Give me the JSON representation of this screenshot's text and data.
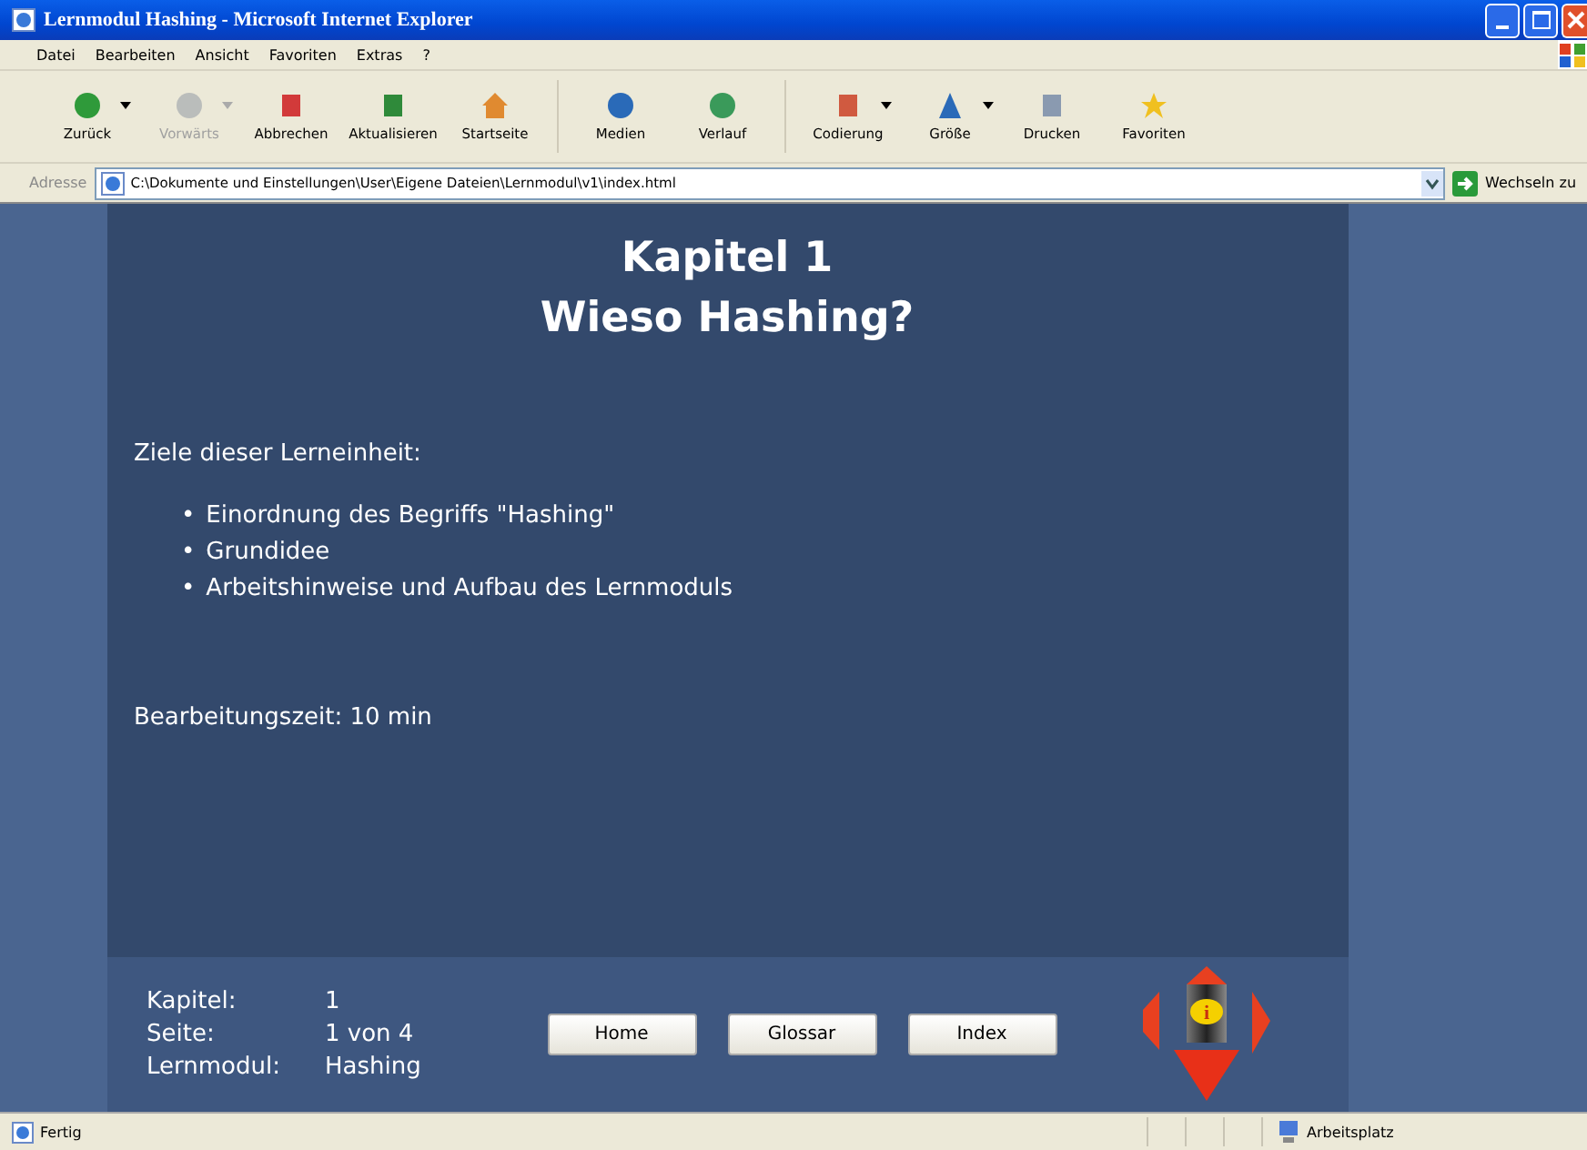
{
  "window": {
    "title": "Lernmodul Hashing - Microsoft Internet Explorer"
  },
  "menu": [
    "Datei",
    "Bearbeiten",
    "Ansicht",
    "Favoriten",
    "Extras",
    "?"
  ],
  "toolbar": [
    {
      "kind": "back",
      "label": "Zurück",
      "disabled": false,
      "dropdown": true
    },
    {
      "kind": "forward",
      "label": "Vorwärts",
      "disabled": true,
      "dropdown": true
    },
    {
      "kind": "stop",
      "label": "Abbrechen",
      "disabled": false,
      "dropdown": false
    },
    {
      "kind": "refresh",
      "label": "Aktualisieren",
      "disabled": false,
      "dropdown": false
    },
    {
      "kind": "home",
      "label": "Startseite",
      "disabled": false,
      "dropdown": false
    },
    {
      "kind": "media",
      "label": "Medien",
      "disabled": false,
      "dropdown": false
    },
    {
      "kind": "history",
      "label": "Verlauf",
      "disabled": false,
      "dropdown": false
    },
    {
      "kind": "encoding",
      "label": "Codierung",
      "disabled": false,
      "dropdown": true
    },
    {
      "kind": "size",
      "label": "Größe",
      "disabled": false,
      "dropdown": true
    },
    {
      "kind": "print",
      "label": "Drucken",
      "disabled": false,
      "dropdown": false
    },
    {
      "kind": "favorites",
      "label": "Favoriten",
      "disabled": false,
      "dropdown": false
    }
  ],
  "address": {
    "label": "Adresse",
    "value": "C:\\Dokumente und Einstellungen\\User\\Eigene Dateien\\Lernmodul\\v1\\index.html",
    "go": "Wechseln zu"
  },
  "page": {
    "heading": [
      "Kapitel 1",
      "Wieso Hashing?"
    ],
    "goals_label": "Ziele dieser Lerneinheit:",
    "bullet": "•",
    "goals": [
      "Einordnung des Begriffs \"Hashing\"",
      "Grundidee",
      "Arbeitshinweise und Aufbau des Lernmoduls"
    ],
    "time": "Bearbeitungszeit: 10 min"
  },
  "footer": {
    "info": [
      {
        "label": "Kapitel:",
        "value": "1"
      },
      {
        "label": "Seite:",
        "value": "1 von 4"
      },
      {
        "label": "Lernmodul:",
        "value": "Hashing"
      }
    ],
    "buttons": [
      "Home",
      "Glossar",
      "Index"
    ],
    "info_glyph": "i"
  },
  "status_bar": {
    "text": "Fertig",
    "zone": "Arbeitsplatz"
  }
}
